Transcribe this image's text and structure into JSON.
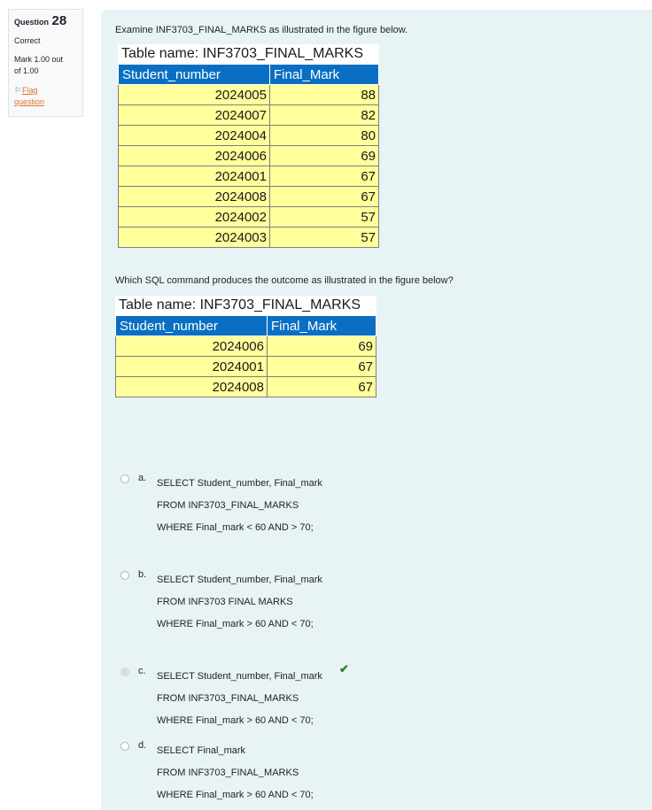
{
  "info": {
    "question_label": "Question",
    "question_number": "28",
    "state": "Correct",
    "grade_line1": "Mark 1.00 out",
    "grade_line2": "of 1.00",
    "flag_line1": "Flag",
    "flag_line2": "question",
    "flag_icon": "flag-icon"
  },
  "question": {
    "intro": "Examine INF3703_FINAL_MARKS as illustrated in the figure below.",
    "prompt": "Which SQL command produces the outcome as illustrated in the figure below?"
  },
  "table1": {
    "title": "Table name: INF3703_FINAL_MARKS",
    "headers": [
      "Student_number",
      "Final_Mark"
    ],
    "rows": [
      [
        "2024005",
        "88"
      ],
      [
        "2024007",
        "82"
      ],
      [
        "2024004",
        "80"
      ],
      [
        "2024006",
        "69"
      ],
      [
        "2024001",
        "67"
      ],
      [
        "2024008",
        "67"
      ],
      [
        "2024002",
        "57"
      ],
      [
        "2024003",
        "57"
      ]
    ]
  },
  "table2": {
    "title": "Table name: INF3703_FINAL_MARKS",
    "headers": [
      "Student_number",
      "Final_Mark"
    ],
    "rows": [
      [
        "2024006",
        "69"
      ],
      [
        "2024001",
        "67"
      ],
      [
        "2024008",
        "67"
      ]
    ]
  },
  "options": [
    {
      "letter": "a.",
      "lines": [
        "SELECT Student_number, Final_mark",
        "FROM INF3703_FINAL_MARKS",
        "WHERE Final_mark < 60 AND > 70;"
      ],
      "selected": false,
      "correct": false
    },
    {
      "letter": "b.",
      "lines": [
        "SELECT Student_number, Final_mark",
        "FROM INF3703 FINAL MARKS",
        "WHERE Final_mark > 60 AND < 70;"
      ],
      "selected": false,
      "correct": false
    },
    {
      "letter": "c.",
      "lines": [
        "SELECT Student_number, Final_mark",
        "FROM INF3703_FINAL_MARKS",
        "WHERE Final_mark > 60 AND < 70;"
      ],
      "selected": true,
      "correct": true
    },
    {
      "letter": "d.",
      "lines": [
        "SELECT Final_mark",
        "FROM INF3703_FINAL_MARKS",
        "WHERE Final_mark > 60 AND < 70;"
      ],
      "selected": false,
      "correct": false
    }
  ],
  "colors": {
    "header_blue": "#0a6fc2",
    "cell_yellow": "#ffff9c",
    "content_bg": "#e7f3f5",
    "correct_green": "#357a32",
    "flag_orange": "#e0732d"
  }
}
